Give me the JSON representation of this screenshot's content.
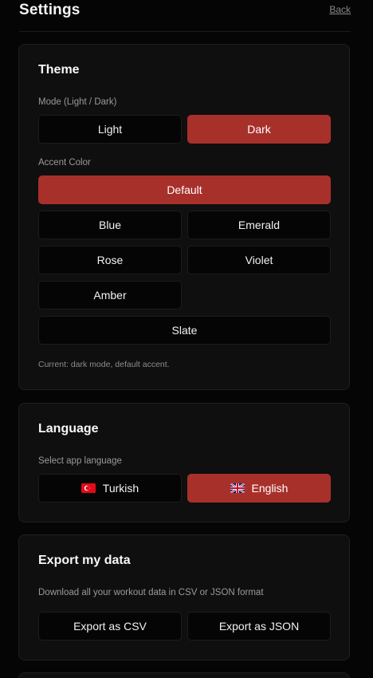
{
  "header": {
    "title": "Settings",
    "back_label": "Back"
  },
  "theme": {
    "title": "Theme",
    "mode_label": "Mode (Light / Dark)",
    "modes": [
      "Light",
      "Dark"
    ],
    "selected_mode": "Dark",
    "accent_label": "Accent Color",
    "accents": [
      "Default",
      "Blue",
      "Emerald",
      "Rose",
      "Violet",
      "Amber",
      "Slate"
    ],
    "selected_accent": "Default",
    "current_text": "Current: dark mode, default accent."
  },
  "language": {
    "title": "Language",
    "select_label": "Select app language",
    "options": [
      {
        "label": "Turkish",
        "flag_icon": "turkey-flag-icon"
      },
      {
        "label": "English",
        "flag_icon": "uk-flag-icon"
      }
    ],
    "selected": "English"
  },
  "export": {
    "title": "Export my data",
    "description": "Download all your workout data in CSV or JSON format",
    "csv_label": "Export as CSV",
    "json_label": "Export as JSON"
  },
  "colors": {
    "accent": "#a8302b",
    "background": "#050505",
    "card": "#0f0f0f"
  }
}
